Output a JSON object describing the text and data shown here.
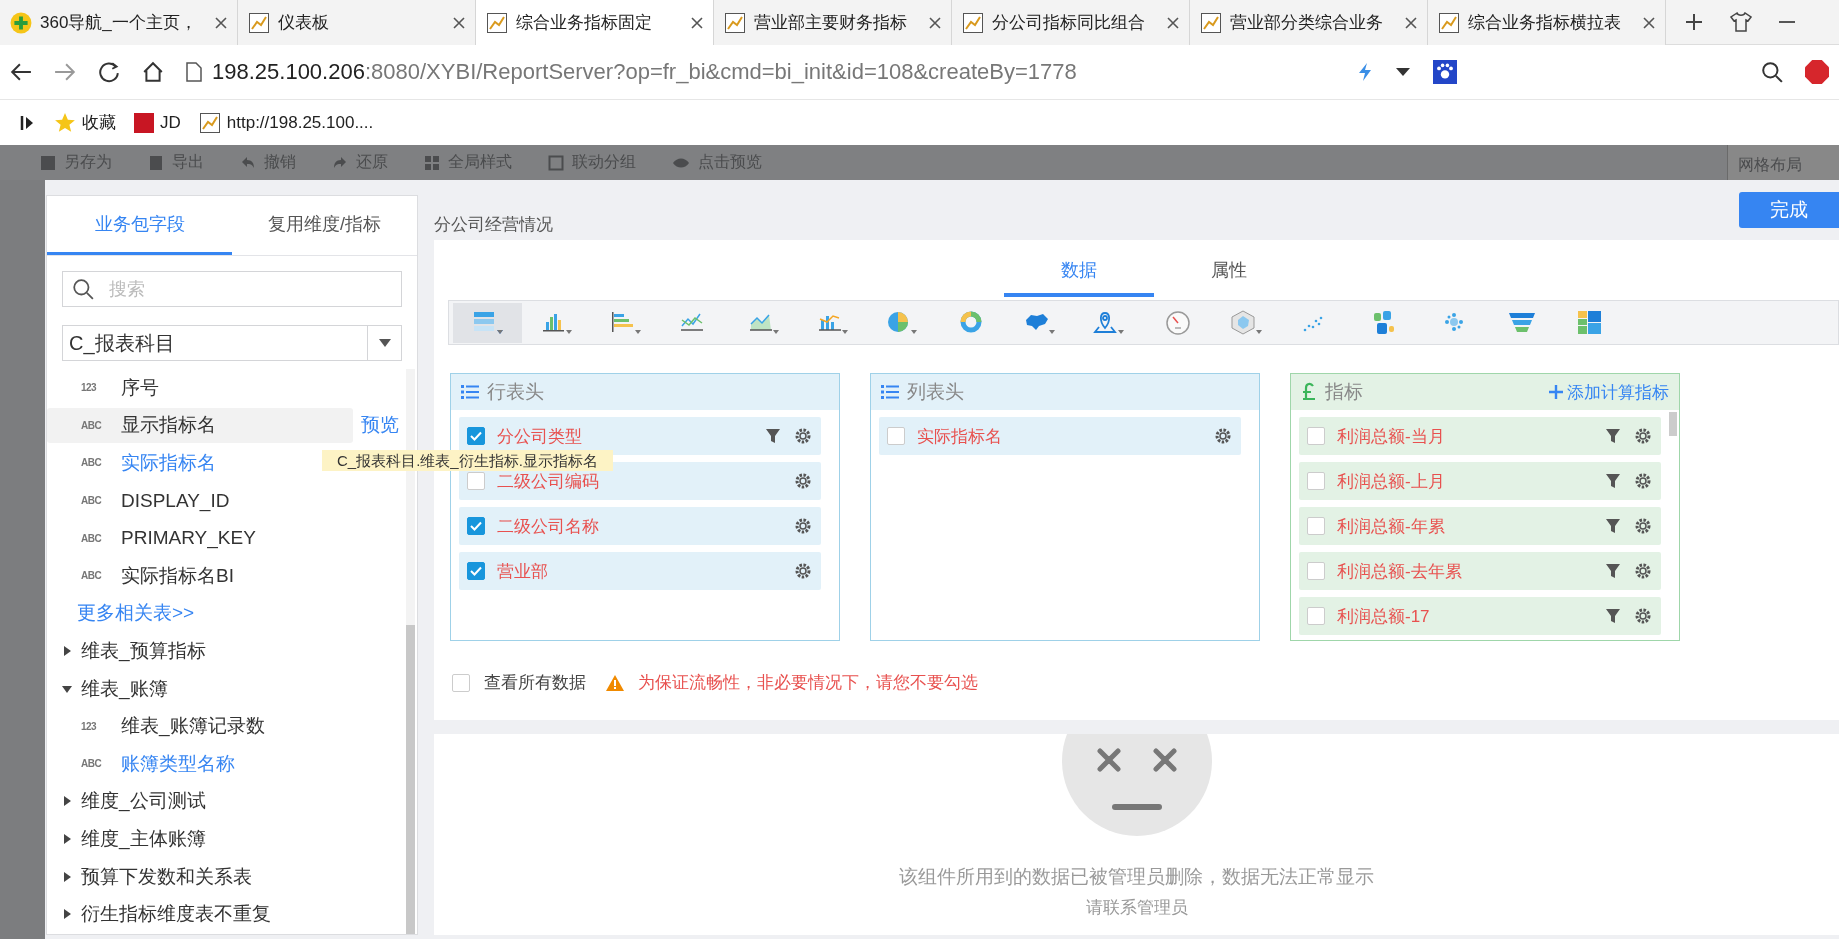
{
  "browser": {
    "tabs": [
      {
        "label": "360导航_一个主页，",
        "selected": false,
        "kind": "home"
      },
      {
        "label": "仪表板",
        "selected": false,
        "kind": "report"
      },
      {
        "label": "综合业务指标固定",
        "selected": true,
        "kind": "report"
      },
      {
        "label": "营业部主要财务指标",
        "selected": false,
        "kind": "report"
      },
      {
        "label": "分公司指标同比组合",
        "selected": false,
        "kind": "report"
      },
      {
        "label": "营业部分类综合业务",
        "selected": false,
        "kind": "report"
      },
      {
        "label": "综合业务指标横拉表",
        "selected": false,
        "kind": "report"
      }
    ],
    "url_host": "198.25.100.206",
    "url_rest": ":8080/XYBI/ReportServer?op=fr_bi&cmd=bi_init&id=108&createBy=1778",
    "bookmarks": [
      {
        "label": "收藏",
        "kind": "star"
      },
      {
        "label": "JD",
        "kind": "jd"
      },
      {
        "label": "http://198.25.100....",
        "kind": "report"
      }
    ]
  },
  "toolbar": [
    {
      "label": "另存为",
      "kind": "save"
    },
    {
      "label": "导出",
      "kind": "export"
    },
    {
      "label": "撤销",
      "kind": "undo"
    },
    {
      "label": "还原",
      "kind": "redo"
    },
    {
      "label": "全局样式",
      "kind": "grid"
    },
    {
      "label": "联动分组",
      "kind": "link"
    },
    {
      "label": "点击预览",
      "kind": "eye"
    }
  ],
  "toolbar_right": "网格布局",
  "sidebar": {
    "tabs": [
      {
        "label": "业务包字段",
        "selected": true
      },
      {
        "label": "复用维度/指标",
        "selected": false
      }
    ],
    "search": {
      "placeholder": "搜索"
    },
    "table_select": "C_报表科目",
    "fields": [
      {
        "type": "123",
        "name": "序号",
        "used": false,
        "hovered": false
      },
      {
        "type": "ABC",
        "name": "显示指标名",
        "used": false,
        "hovered": true
      },
      {
        "type": "ABC",
        "name": "实际指标名",
        "used": true,
        "hovered": false
      },
      {
        "type": "ABC",
        "name": "DISPLAY_ID",
        "used": false,
        "hovered": false
      },
      {
        "type": "ABC",
        "name": "PRIMARY_KEY",
        "used": false,
        "hovered": false
      },
      {
        "type": "ABC",
        "name": "实际指标名BI",
        "used": false,
        "hovered": false
      }
    ],
    "preview_link": "预览",
    "more_link": "更多相关表>>",
    "groups": [
      {
        "name": "维表_预算指标",
        "expanded": false
      },
      {
        "name": "维表_账簿",
        "expanded": true,
        "children": [
          {
            "type": "123",
            "name": "维表_账簿记录数",
            "used": false,
            "hovered": false
          },
          {
            "type": "ABC",
            "name": "账簿类型名称",
            "used": true,
            "hovered": false
          }
        ]
      },
      {
        "name": "维度_公司测试",
        "expanded": false
      },
      {
        "name": "维度_主体账簿",
        "expanded": false
      },
      {
        "name": "预算下发数和关系表",
        "expanded": false
      },
      {
        "name": "衍生指标维度表不重复",
        "expanded": false
      }
    ]
  },
  "tooltip": "C_报表科目.维表_衍生指标.显示指标名",
  "widget_title": "分公司经营情况",
  "done_button": "完成",
  "config_tabs": [
    {
      "label": "数据",
      "selected": true
    },
    {
      "label": "属性",
      "selected": false
    }
  ],
  "chart_types": [
    {
      "kind": "table",
      "selected": true,
      "menu": true
    },
    {
      "kind": "bar",
      "selected": false,
      "menu": true
    },
    {
      "kind": "hbar",
      "selected": false,
      "menu": true
    },
    {
      "kind": "line",
      "selected": false,
      "menu": false
    },
    {
      "kind": "area",
      "selected": false,
      "menu": true
    },
    {
      "kind": "combo",
      "selected": false,
      "menu": true
    },
    {
      "kind": "pie",
      "selected": false,
      "menu": true
    },
    {
      "kind": "donut",
      "selected": false,
      "menu": false
    },
    {
      "kind": "map",
      "selected": false,
      "menu": true
    },
    {
      "kind": "pin",
      "selected": false,
      "menu": true
    },
    {
      "kind": "gauge",
      "selected": false,
      "menu": false
    },
    {
      "kind": "radar",
      "selected": false,
      "menu": true
    },
    {
      "kind": "scatter",
      "selected": false,
      "menu": false
    },
    {
      "kind": "cloud",
      "selected": false,
      "menu": false
    },
    {
      "kind": "bubble",
      "selected": false,
      "menu": false
    },
    {
      "kind": "funnel",
      "selected": false,
      "menu": false
    },
    {
      "kind": "treemap",
      "selected": false,
      "menu": false
    }
  ],
  "regions": [
    {
      "title": "行表头",
      "kind": "dimension",
      "items": [
        {
          "name": "分公司类型",
          "checked": true,
          "filter": true
        },
        {
          "name": "二级公司编码",
          "checked": false,
          "filter": false
        },
        {
          "name": "二级公司名称",
          "checked": true,
          "filter": false
        },
        {
          "name": "营业部",
          "checked": true,
          "filter": false
        }
      ]
    },
    {
      "title": "列表头",
      "kind": "dimension",
      "items": [
        {
          "name": "实际指标名",
          "checked": false,
          "filter": false
        }
      ]
    },
    {
      "title": "指标",
      "kind": "measure",
      "action": "添加计算指标",
      "items": [
        {
          "name": "利润总额-当月",
          "checked": false,
          "filter": true
        },
        {
          "name": "利润总额-上月",
          "checked": false,
          "filter": true
        },
        {
          "name": "利润总额-年累",
          "checked": false,
          "filter": true
        },
        {
          "name": "利润总额-去年累",
          "checked": false,
          "filter": true
        },
        {
          "name": "利润总额-17",
          "checked": false,
          "filter": true
        }
      ]
    }
  ],
  "show_all": {
    "label": "查看所有数据",
    "checked": false
  },
  "warning": "为保证流畅性，非必要情况下，请您不要勾选",
  "empty_message": "该组件所用到的数据已被管理员删除，数据无法正常显示",
  "empty_message_2": "请联系管理员"
}
